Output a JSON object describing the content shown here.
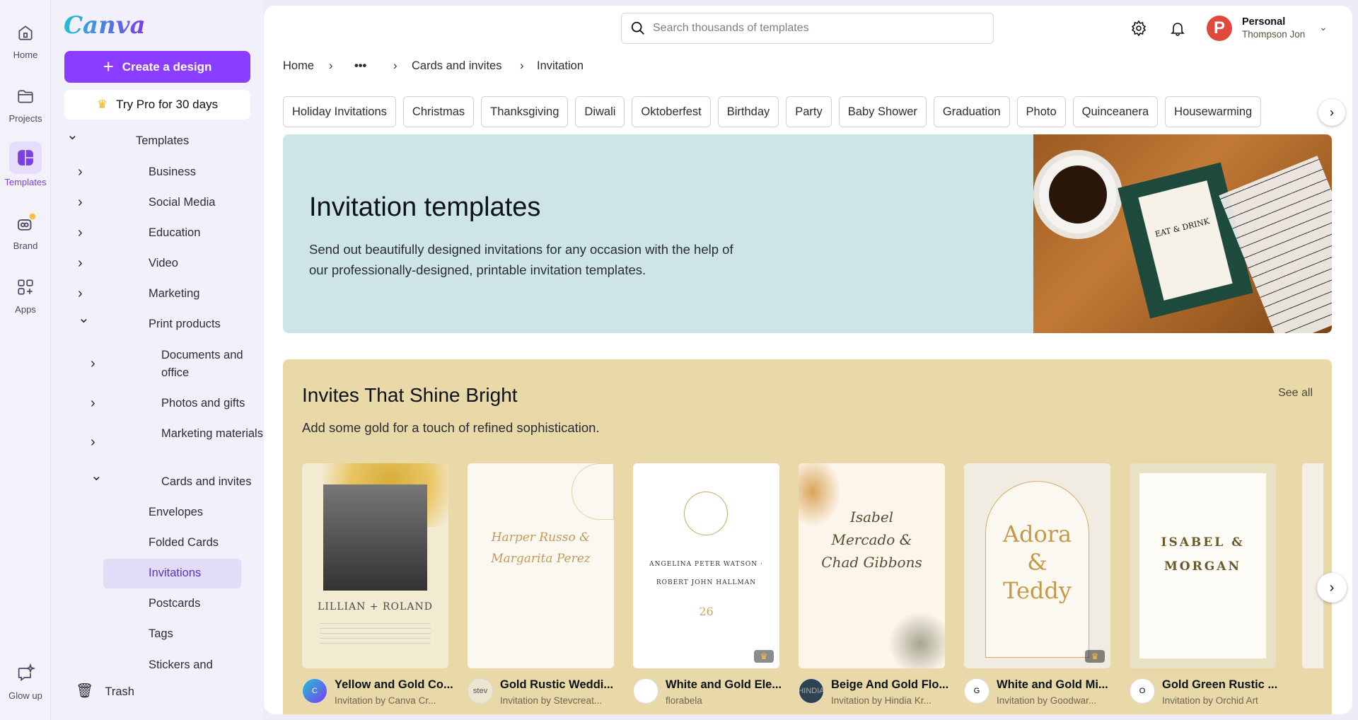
{
  "rail": [
    {
      "label": "Home",
      "icon": "home-icon"
    },
    {
      "label": "Projects",
      "icon": "folder-icon"
    },
    {
      "label": "Templates",
      "icon": "templates-icon",
      "active": true
    },
    {
      "label": "Brand",
      "icon": "brand-icon"
    },
    {
      "label": "Apps",
      "icon": "apps-icon"
    },
    {
      "label": "Glow up",
      "icon": "glow-up-icon"
    }
  ],
  "sidebar": {
    "logo": "Canva",
    "create": "Create a design",
    "trypro": "Try Pro for 30 days",
    "tree": [
      "Templates",
      "Business",
      "Social Media",
      "Education",
      "Video",
      "Marketing",
      "Print products",
      "Documents and office",
      "Photos and gifts",
      "Marketing materials",
      "Cards and invites",
      "Envelopes",
      "Folded Cards",
      "Invitations",
      "Postcards",
      "Tags",
      "Stickers and"
    ],
    "trash": "Trash"
  },
  "header": {
    "search_placeholder": "Search thousands of templates",
    "account_type": "Personal",
    "user": "Thompson Jon",
    "avatar_letter": "P"
  },
  "breadcrumb": [
    "Home",
    "•••",
    "Cards and invites",
    "Invitation"
  ],
  "chips": [
    "Holiday Invitations",
    "Christmas",
    "Thanksgiving",
    "Diwali",
    "Oktoberfest",
    "Birthday",
    "Party",
    "Baby Shower",
    "Graduation",
    "Photo",
    "Quinceanera",
    "Housewarming"
  ],
  "hero": {
    "title": "Invitation templates",
    "description": "Send out beautifully designed invitations for any occasion with the help of our professionally-designed, printable invitation templates.",
    "card_text": "EAT & DRINK"
  },
  "section": {
    "title": "Invites That Shine Bright",
    "see_all": "See all",
    "subtitle": "Add some gold for a touch of refined sophistication.",
    "cards": [
      {
        "title": "Yellow and Gold Co...",
        "by": "Invitation by Canva Cr...",
        "thumb": "LILLIAN + ROLAND",
        "avatar": "C"
      },
      {
        "title": "Gold Rustic Weddi...",
        "by": "Invitation by Stevcreat...",
        "thumb": "Harper Russo & Margarita Perez",
        "avatar": "stev"
      },
      {
        "title": "White and Gold Ele...",
        "by": "florabela",
        "thumb": "ANGELINA PETER WATSON · ROBERT JOHN HALLMAN",
        "avatar": "",
        "pro": true
      },
      {
        "title": "Beige And Gold Flo...",
        "by": "Invitation by Hindia Kr...",
        "thumb": "Isabel Mercado & Chad Gibbons",
        "avatar": "HINDIA"
      },
      {
        "title": "White and Gold Mi...",
        "by": "Invitation by Goodwar...",
        "thumb": "Adora & Teddy",
        "avatar": "G",
        "pro": true
      },
      {
        "title": "Gold Green Rustic ...",
        "by": "Invitation by Orchid Art",
        "thumb": "ISABEL & MORGAN",
        "avatar": "O"
      }
    ]
  },
  "colors": {
    "accent": "#8b3dff",
    "hero_bg": "#cde6e5",
    "section_bg": "#e9d9a9"
  }
}
